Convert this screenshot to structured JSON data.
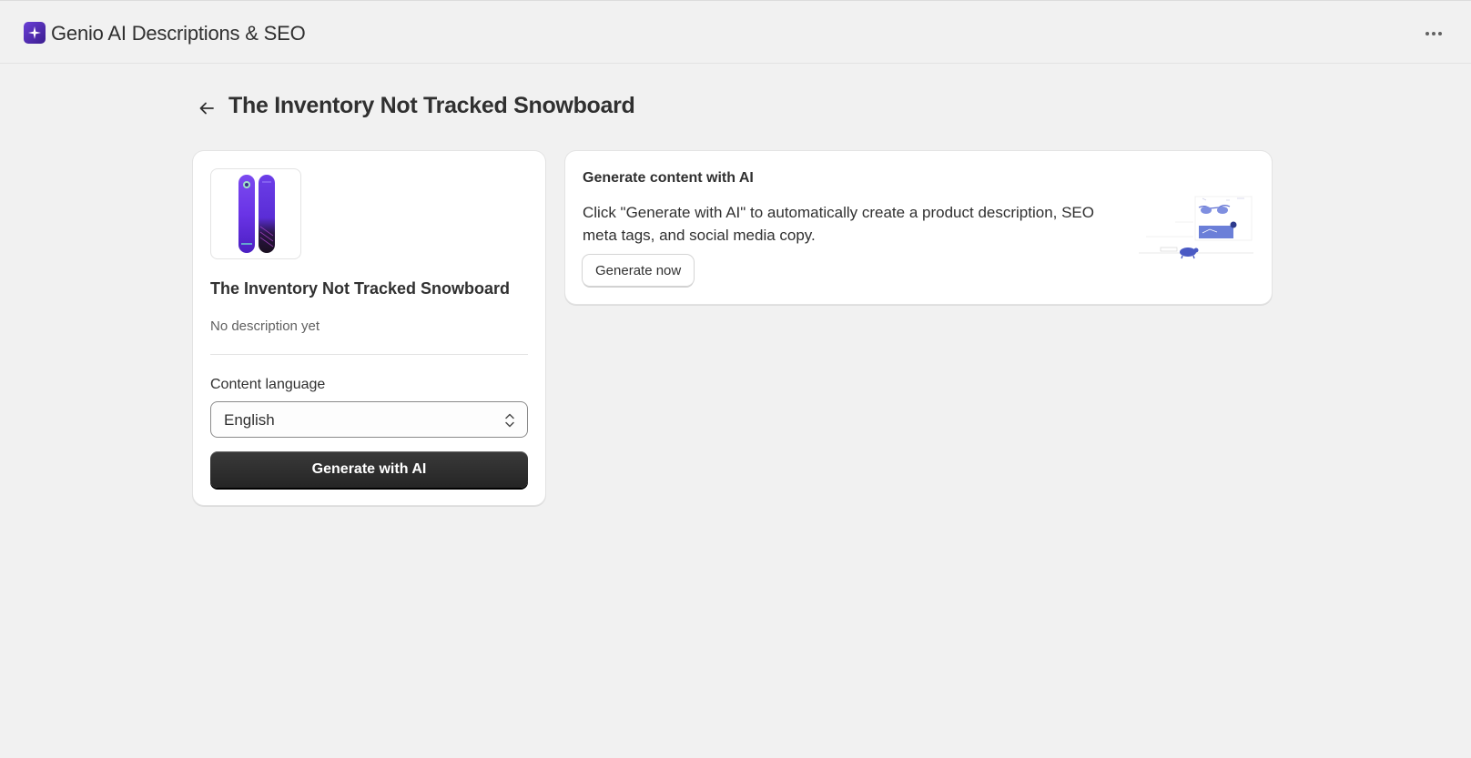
{
  "app": {
    "title": "Genio AI Descriptions & SEO",
    "logo_icon": "sparkle-icon",
    "menu_icon": "more-horizontal-icon"
  },
  "page": {
    "title": "The Inventory Not Tracked Snowboard",
    "back_icon": "arrow-left-icon"
  },
  "product_card": {
    "name": "The Inventory Not Tracked Snowboard",
    "description_status": "No description yet",
    "language_label": "Content language",
    "language_value": "English",
    "generate_button": "Generate with AI"
  },
  "generate_card": {
    "title": "Generate content with AI",
    "body": "Click \"Generate with AI\" to automatically create a product description, SEO meta tags, and social media copy.",
    "button": "Generate now"
  },
  "colors": {
    "background": "#f1f1f1",
    "card": "#ffffff",
    "primary_button": "#303030",
    "brand": "#5b34c9",
    "illustration_accent": "#5f6fd1"
  }
}
